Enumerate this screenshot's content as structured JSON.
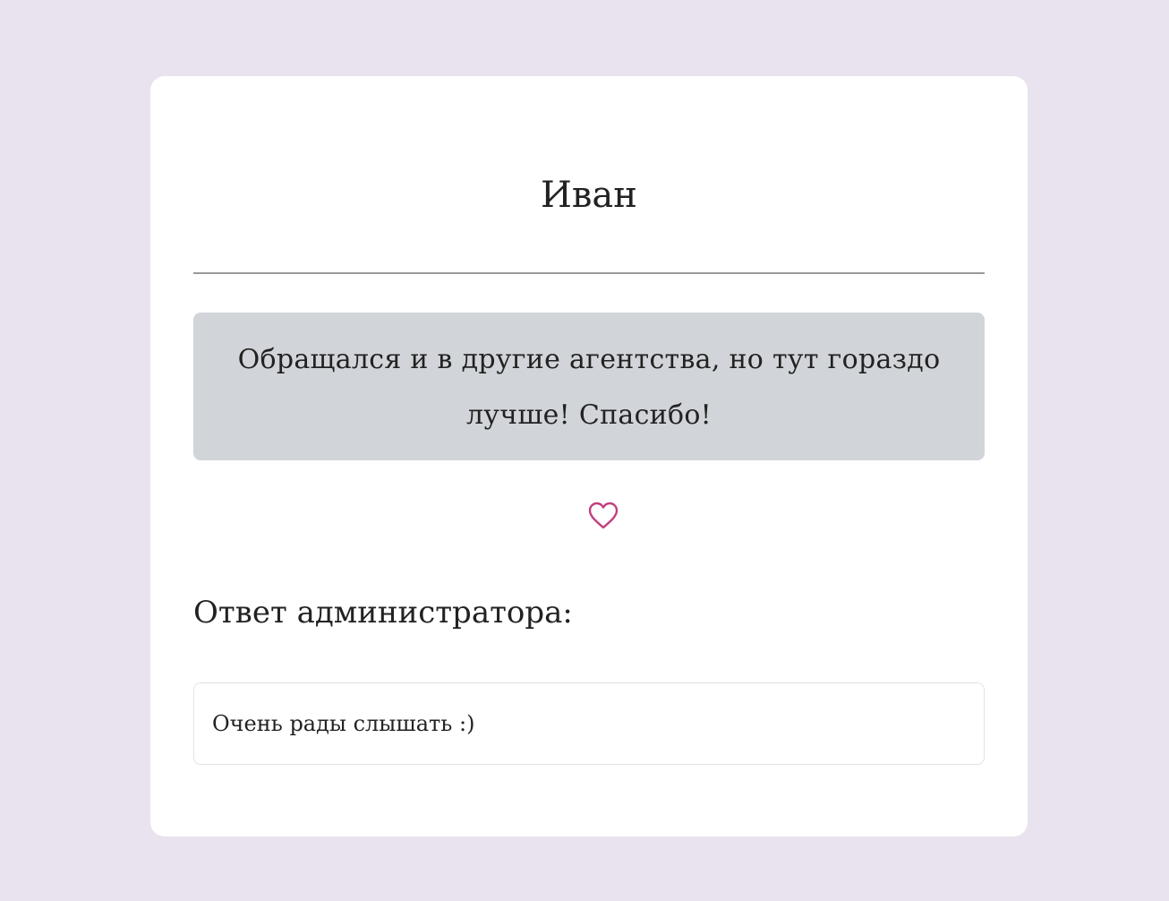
{
  "review": {
    "author": "Иван",
    "text": "Обращался и в другие агентства, но тут гораздо лучше! Спасибо!",
    "like_icon": "heart-outline-icon",
    "like_color": "#c2407e"
  },
  "admin_reply": {
    "heading": "Ответ администратора:",
    "text": "Очень рады слышать :)"
  },
  "colors": {
    "page_background": "#e8e3ef",
    "card_background": "#ffffff",
    "review_background": "#d1d4d8"
  }
}
